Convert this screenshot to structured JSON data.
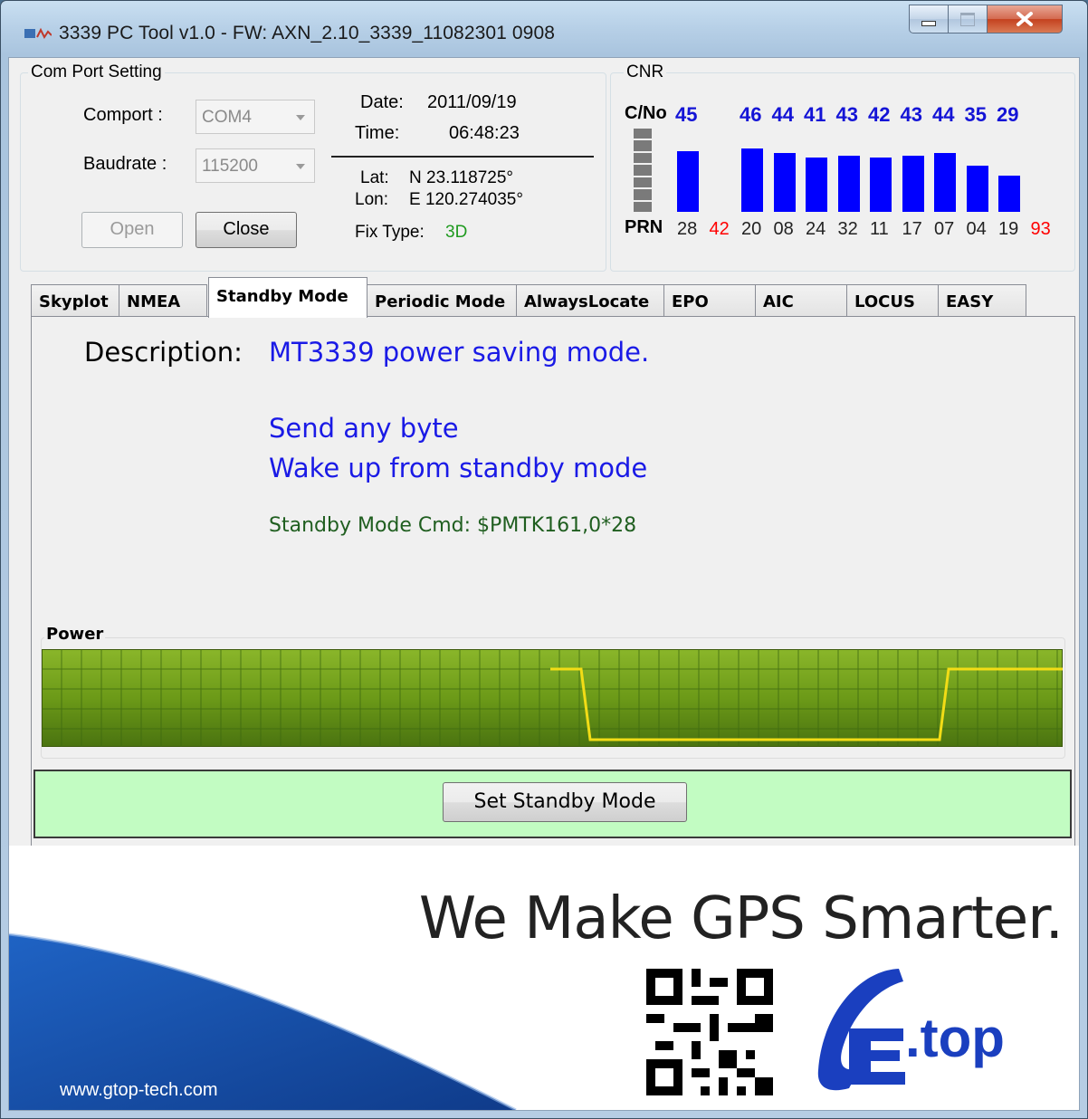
{
  "window": {
    "title": "3339 PC Tool v1.0 - FW: AXN_2.10_3339_11082301 0908"
  },
  "com_port": {
    "group_label": "Com Port Setting",
    "comport_label": "Comport :",
    "comport_value": "COM4",
    "baudrate_label": "Baudrate :",
    "baudrate_value": "115200",
    "open_label": "Open",
    "close_label": "Close",
    "date_label": "Date:",
    "date_value": "2011/09/19",
    "time_label": "Time:",
    "time_value": "06:48:23",
    "lat_label": "Lat:",
    "lat_value": "N 23.118725°",
    "lon_label": "Lon:",
    "lon_value": "E 120.274035°",
    "fix_label": "Fix Type:",
    "fix_value": "3D"
  },
  "cnr": {
    "group_label": "CNR",
    "cno_label": "C/No",
    "prn_label": "PRN",
    "satellites": [
      {
        "prn": "28",
        "cno": "45",
        "used": true,
        "level": 0.76
      },
      {
        "prn": "42",
        "cno": "",
        "used": false,
        "level": 0
      },
      {
        "prn": "20",
        "cno": "46",
        "used": true,
        "level": 0.79
      },
      {
        "prn": "08",
        "cno": "44",
        "used": true,
        "level": 0.74
      },
      {
        "prn": "24",
        "cno": "41",
        "used": true,
        "level": 0.68
      },
      {
        "prn": "32",
        "cno": "43",
        "used": true,
        "level": 0.7
      },
      {
        "prn": "11",
        "cno": "42",
        "used": true,
        "level": 0.68
      },
      {
        "prn": "17",
        "cno": "43",
        "used": true,
        "level": 0.7
      },
      {
        "prn": "07",
        "cno": "44",
        "used": true,
        "level": 0.74
      },
      {
        "prn": "04",
        "cno": "35",
        "used": true,
        "level": 0.58
      },
      {
        "prn": "19",
        "cno": "29",
        "used": true,
        "level": 0.46
      },
      {
        "prn": "93",
        "cno": "",
        "used": false,
        "level": 0
      }
    ],
    "colors": {
      "bar": "#0000ff",
      "used_prn": "#222222",
      "unused_prn": "#ff0000",
      "cno_text": "#1414d6"
    }
  },
  "tabs": [
    {
      "label": "Skyplot"
    },
    {
      "label": "NMEA"
    },
    {
      "label": "Standby Mode",
      "active": true
    },
    {
      "label": "Periodic Mode"
    },
    {
      "label": "AlwaysLocate"
    },
    {
      "label": "EPO"
    },
    {
      "label": "AIC"
    },
    {
      "label": "LOCUS"
    },
    {
      "label": "EASY"
    }
  ],
  "standby": {
    "description_label": "Description:",
    "description_text": "MT3339 power saving mode.",
    "line1": "Send any byte",
    "line2": "Wake up from standby mode",
    "cmd": "Standby Mode Cmd: $PMTK161,0*28",
    "power_label": "Power",
    "set_button": "Set Standby Mode",
    "colors": {
      "desc_blue": "#1a1ae6",
      "cmd_green": "#1f5e1f",
      "panel_green": "#c2fcc2"
    }
  },
  "banner": {
    "slogan": "We Make GPS Smarter.",
    "url": "www.gtop-tech.com",
    "logo_text": ".top"
  }
}
